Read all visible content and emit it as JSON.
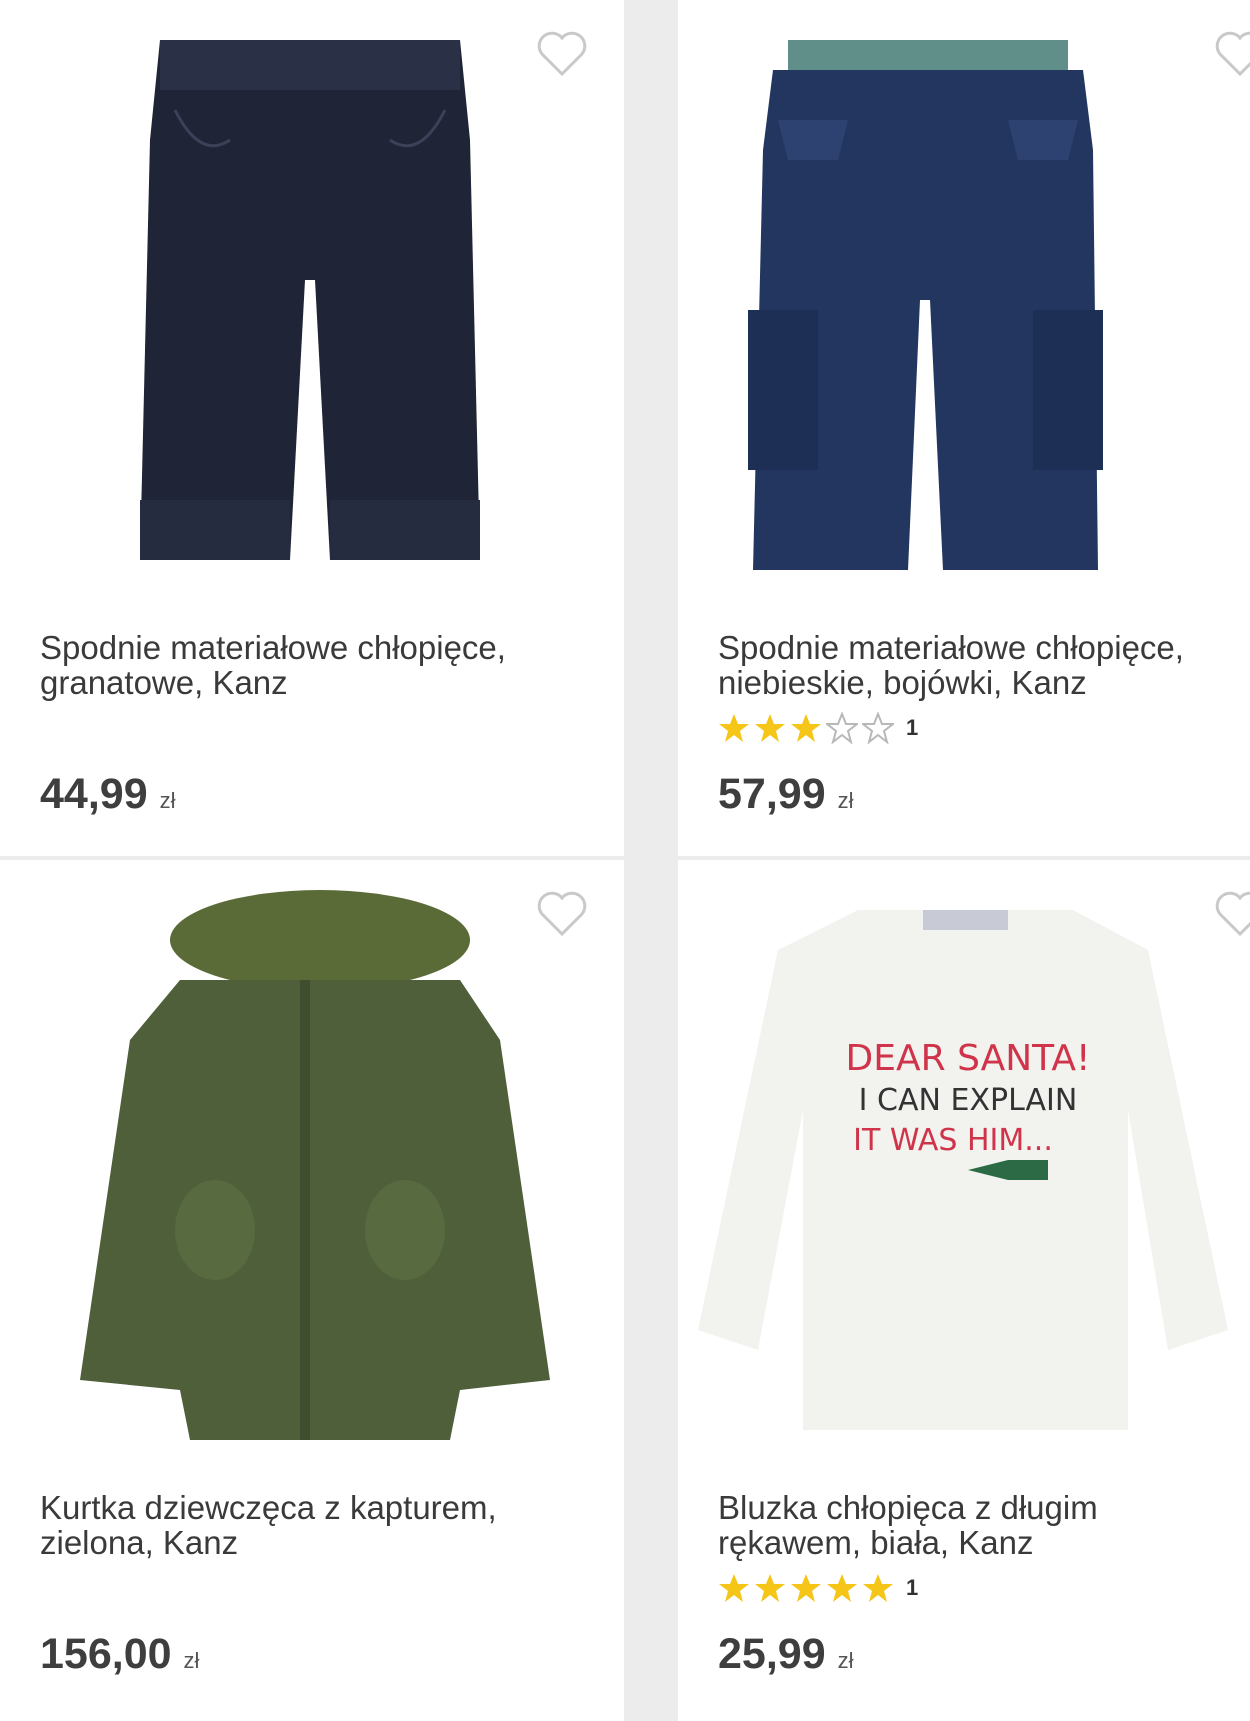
{
  "colors": {
    "star": "#f5c518",
    "star_outline": "#b8b8b8",
    "heart": "#c9c9c9"
  },
  "products": [
    {
      "title": "Spodnie materiałowe chłopięce, granatowe, Kanz",
      "price": "44,99",
      "currency": "zł",
      "favorite_icon": "heart-outline-icon"
    },
    {
      "title": "Spodnie materiałowe chłopięce, niebieskie, bojówki, Kanz",
      "rating": 3,
      "rating_max": 5,
      "rating_count": "1",
      "price": "57,99",
      "currency": "zł",
      "favorite_icon": "heart-outline-icon"
    },
    {
      "title": "Kurtka dziewczęca z kapturem, zielona, Kanz",
      "price": "156,00",
      "currency": "zł",
      "favorite_icon": "heart-outline-icon"
    },
    {
      "title": "Bluzka chłopięca z długim rękawem, biała, Kanz",
      "rating": 5,
      "rating_max": 5,
      "rating_count": "1",
      "price": "25,99",
      "currency": "zł",
      "favorite_icon": "heart-outline-icon",
      "print_text": [
        "DEAR SANTA!",
        "I CAN EXPLAIN",
        "IT WAS HIM..."
      ]
    }
  ]
}
